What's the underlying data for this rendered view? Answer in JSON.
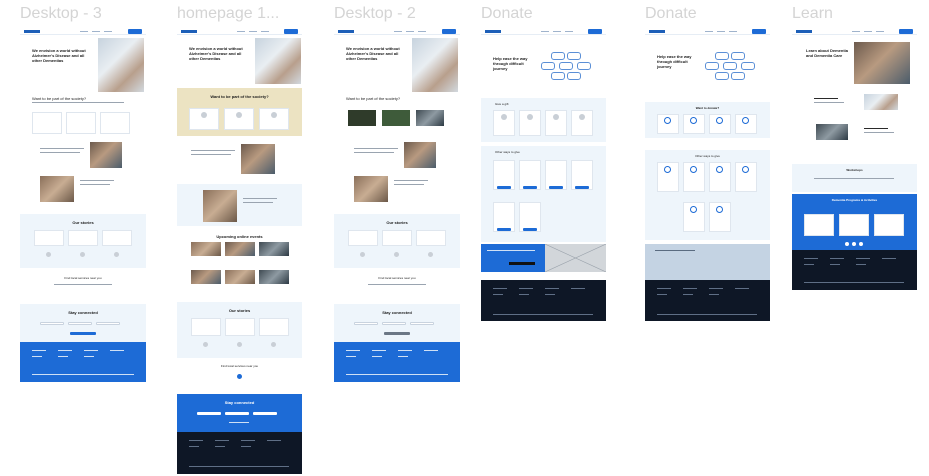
{
  "frames": [
    {
      "label": "Desktop - 3"
    },
    {
      "label": "homepage 1..."
    },
    {
      "label": "Desktop - 2"
    },
    {
      "label": "Donate"
    },
    {
      "label": "Donate"
    },
    {
      "label": "Learn"
    }
  ],
  "desktop3": {
    "hero_title": "We envision a world without Alzheimer's Disease and all other Dementias",
    "section_title": "Want to be part of the society?",
    "stories_title": "Our stories",
    "find_services": "Find local services near you",
    "stay_connected": "Stay connected"
  },
  "homepage": {
    "hero_title": "We envision a world without Alzheimer's Disease and all other Dementias",
    "section_title": "Want to be part of the society?",
    "events_title": "Upcoming online events",
    "stories_title": "Our stories",
    "find_services": "Find local services near you",
    "stay_connected": "Stay connected"
  },
  "desktop2": {
    "hero_title": "We envision a world without Alzheimer's Disease and all other Dementias",
    "section_title": "Want to be part of the society?",
    "stories_title": "Our stories",
    "find_services": "Find local services near you",
    "stay_connected": "Stay connected"
  },
  "donate1": {
    "hero_title": "Help ease the way through difficult journey",
    "section_title": "Give a gift",
    "section2_title": "Other ways to give"
  },
  "donate2": {
    "hero_title": "Help ease the way through difficult journey",
    "section_title": "Want to donate?",
    "section2_title": "Other ways to give"
  },
  "learn": {
    "hero_title": "Learn about Dementia and Dementia Care",
    "workshops_title": "Workshops",
    "programs_title": "Dementia Programs & Activities"
  },
  "colors": {
    "brand_blue": "#1d6bd6",
    "light_blue": "#eef5fb",
    "beige": "#ece3c2",
    "footer_navy": "#0e1726",
    "frame_label": "#d4d4d4"
  }
}
